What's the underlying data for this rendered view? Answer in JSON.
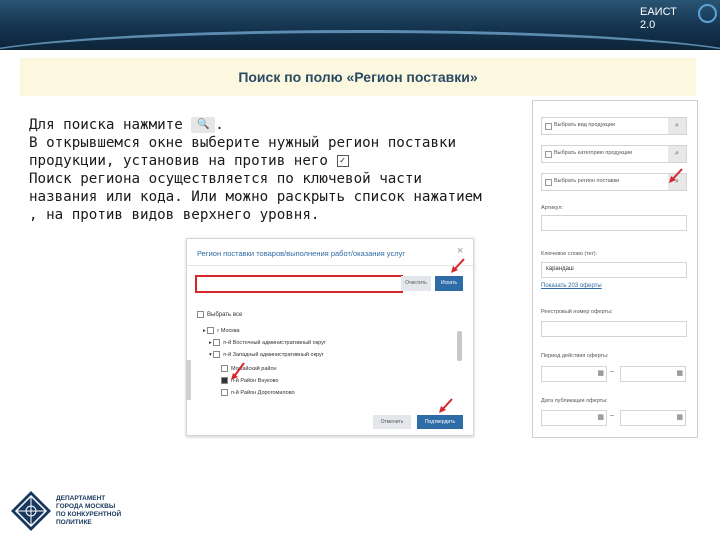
{
  "header": {
    "brand_line1": "ЕАИСТ",
    "brand_line2": "2.0"
  },
  "title": "Поиск по полю «Регион поставки»",
  "instructions": {
    "line1_a": "Для поиска нажмите",
    "search_glyph": "🔍",
    "line1_b": ".",
    "line2": "В открывшемся окне выберите нужный регион поставки",
    "line3": "продукции, установив на против него",
    "check_glyph": "✓",
    "line4": "Поиск региона осуществляется по ключевой части",
    "line5": "названия или кода. Или можно раскрыть список нажатием",
    "line6": ", на против видов верхнего уровня."
  },
  "dialog": {
    "title": "Регион поставки товаров/выполнения работ/оказания услуг",
    "close": "×",
    "clear_button": "Очистить",
    "find_button": "Искать",
    "select_all": "Выбрать все",
    "tree": [
      {
        "label": "г Москва",
        "level": 0,
        "checked": false
      },
      {
        "label": "п-й Восточный административный округ",
        "level": 1,
        "checked": false
      },
      {
        "label": "п-й Западный административный округ",
        "level": 1,
        "checked": false
      },
      {
        "label": "Можайский район",
        "level": 2,
        "checked": false
      },
      {
        "label": "п-й Район Внуково",
        "level": 2,
        "checked": true
      },
      {
        "label": "п-й Район Дорогомилово",
        "level": 2,
        "checked": false
      }
    ],
    "cancel_button": "Отменить",
    "confirm_button": "Подтвердить"
  },
  "panel": {
    "field1": "Выбрать вид продукции",
    "field2": "Выбрать категорию продукции",
    "field3": "Выбрать регион поставки",
    "label_article": "Артикул:",
    "label_keyword": "Ключевое слово (тег):",
    "keyword_value": "карандаш",
    "offers_link": "Показать 203 оферты",
    "label_registry": "Реестровый номер оферты:",
    "label_period": "Период действия оферты:",
    "label_publish": "Дата публикации оферты:",
    "dash": "–"
  },
  "logo": {
    "line1": "ДЕПАРТАМЕНТ",
    "line2": "ГОРОДА МОСКВЫ",
    "line3": "ПО КОНКУРЕНТНОЙ",
    "line4": "ПОЛИТИКЕ"
  },
  "colors": {
    "header_dark": "#14344f",
    "title_band": "#fbf8df",
    "accent_blue": "#2e6ca8",
    "highlight_red": "#d4262c"
  }
}
